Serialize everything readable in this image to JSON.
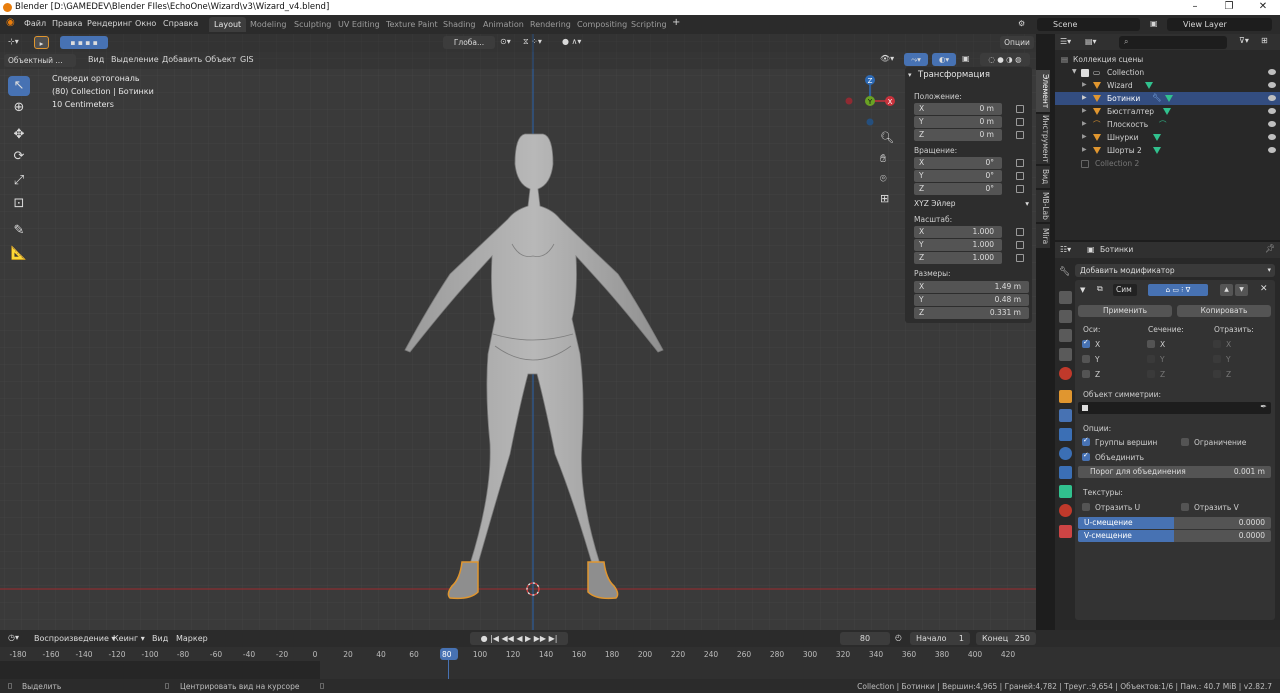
{
  "titlebar": {
    "title": "Blender [D:\\GAMEDEV\\Blender FIles\\EchoOne\\Wizard\\v3\\Wizard_v4.blend]"
  },
  "menu": [
    "Файл",
    "Правка",
    "Рендеринг",
    "Окно",
    "Справка"
  ],
  "workspaces": [
    "Layout",
    "Modeling",
    "Sculpting",
    "UV Editing",
    "Texture Paint",
    "Shading",
    "Animation",
    "Rendering",
    "Compositing",
    "Scripting"
  ],
  "scene": {
    "name": "Scene",
    "view_layer": "View Layer"
  },
  "viewport": {
    "options_label": "Опции",
    "transform_orient": "Глоба...",
    "mode": "Объектный ...",
    "header_menu": [
      "Вид",
      "Выделение",
      "Добавить",
      "Объект",
      "GIS"
    ],
    "overlay": {
      "view_name": "Спереди ортогональ",
      "collection": "(80) Collection | Ботинки",
      "scale": "10 Centimeters"
    },
    "gizmo": {
      "z": "Z",
      "y": "Y",
      "x": "X"
    }
  },
  "npanel": {
    "title": "Трансформация",
    "location_label": "Положение:",
    "location": [
      {
        "axis": "X",
        "value": "0 m"
      },
      {
        "axis": "Y",
        "value": "0 m"
      },
      {
        "axis": "Z",
        "value": "0 m"
      }
    ],
    "rotation_label": "Вращение:",
    "rotation": [
      {
        "axis": "X",
        "value": "0°"
      },
      {
        "axis": "Y",
        "value": "0°"
      },
      {
        "axis": "Z",
        "value": "0°"
      }
    ],
    "rotation_mode": "XYZ Эйлер",
    "scale_label": "Масштаб:",
    "scale": [
      {
        "axis": "X",
        "value": "1.000"
      },
      {
        "axis": "Y",
        "value": "1.000"
      },
      {
        "axis": "Z",
        "value": "1.000"
      }
    ],
    "dims_label": "Размеры:",
    "dims": [
      {
        "axis": "X",
        "value": "1.49 m"
      },
      {
        "axis": "Y",
        "value": "0.48 m"
      },
      {
        "axis": "Z",
        "value": "0.331 m"
      }
    ],
    "tabs": [
      "Элемент",
      "Инструмент",
      "Вид",
      "MB-Lab",
      "Mira"
    ]
  },
  "outliner": {
    "root": "Коллекция сцены",
    "collection": "Collection",
    "items": [
      "Wizard",
      "Ботинки",
      "Бюстгалтер",
      "Плоскость",
      "Шнурки",
      "Шорты 2"
    ],
    "collection2": "Collection 2"
  },
  "properties": {
    "object_name": "Ботинки",
    "add_modifier": "Добавить модификатор",
    "modifier_name": "Сим",
    "apply": "Применить",
    "copy": "Копировать",
    "axes_label": "Оси:",
    "bisect_label": "Сечение:",
    "mirror_label": "Отразить:",
    "axes": [
      "X",
      "Y",
      "Z"
    ],
    "mirror_object_label": "Объект симметрии:",
    "options_label": "Опции:",
    "vertex_groups": "Группы вершин",
    "clipping": "Ограничение",
    "merge": "Объединить",
    "merge_threshold_label": "Порог для объединения",
    "merge_threshold": "0.001 m",
    "textures_label": "Текстуры:",
    "mirror_u": "Отразить U",
    "mirror_v": "Отразить V",
    "u_offset_label": "U-смещение",
    "u_offset": "0.0000",
    "v_offset_label": "V-смещение",
    "v_offset": "0.0000"
  },
  "timeline": {
    "playback": "Воспроизведение",
    "keying": "Кеинг",
    "view": "Вид",
    "marker": "Маркер",
    "current_frame": "80",
    "start_label": "Начало",
    "start": "1",
    "end_label": "Конец",
    "end": "250",
    "ruler": [
      "-180",
      "-160",
      "-140",
      "-120",
      "-100",
      "-80",
      "-60",
      "-40",
      "-20",
      "0",
      "20",
      "40",
      "60",
      "80",
      "100",
      "120",
      "140",
      "160",
      "180",
      "200",
      "220",
      "240",
      "260",
      "280",
      "300",
      "320",
      "340",
      "360",
      "380",
      "400",
      "420"
    ]
  },
  "status": {
    "select": "Выделить",
    "center": "Центрировать вид на курсоре",
    "stats": "Collection | Ботинки | Вершин:4,965 | Граней:4,782 | Треуг.:9,654 | Объектов:1/6 | Пам.: 40.7 MiB | v2.82.7"
  }
}
